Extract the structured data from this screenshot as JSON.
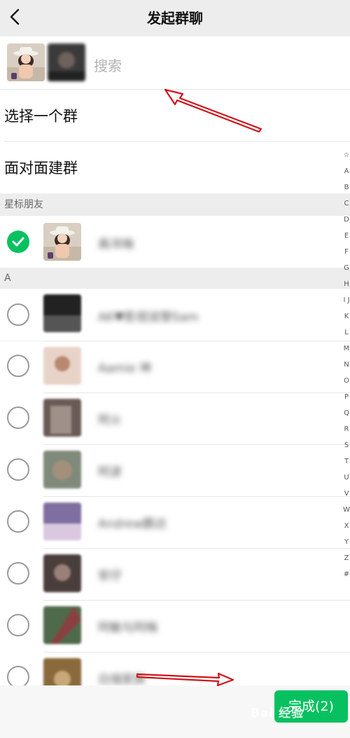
{
  "header": {
    "title": "发起群聊",
    "back_icon": "chevron-left-icon"
  },
  "search": {
    "placeholder": "搜索",
    "selected_count": 2
  },
  "menu": {
    "select_group": "选择一个群",
    "face_to_face": "面对面建群"
  },
  "sections": {
    "starred": "星标朋友",
    "a": "A"
  },
  "contacts": [
    {
      "name": "高洋梅",
      "checked": true
    },
    {
      "name": "AK♥影视说黎Sam",
      "checked": false
    },
    {
      "name": "Aamie 坤",
      "checked": false
    },
    {
      "name": "阿火",
      "checked": false
    },
    {
      "name": "阿波",
      "checked": false
    },
    {
      "name": "Andrew鹏达",
      "checked": false
    },
    {
      "name": "安仔",
      "checked": false
    },
    {
      "name": "阿敏与阿梅",
      "checked": false
    },
    {
      "name": "白瑞家族",
      "checked": false
    }
  ],
  "done_button": {
    "label": "完成(2)"
  },
  "watermark": "Bai 经验",
  "side_index": "☆ A B C D E F G H I J K L M N O P Q R S T U V W X Y Z #",
  "colors": {
    "accent": "#07c160",
    "annotation_arrow": "#d0141a"
  }
}
